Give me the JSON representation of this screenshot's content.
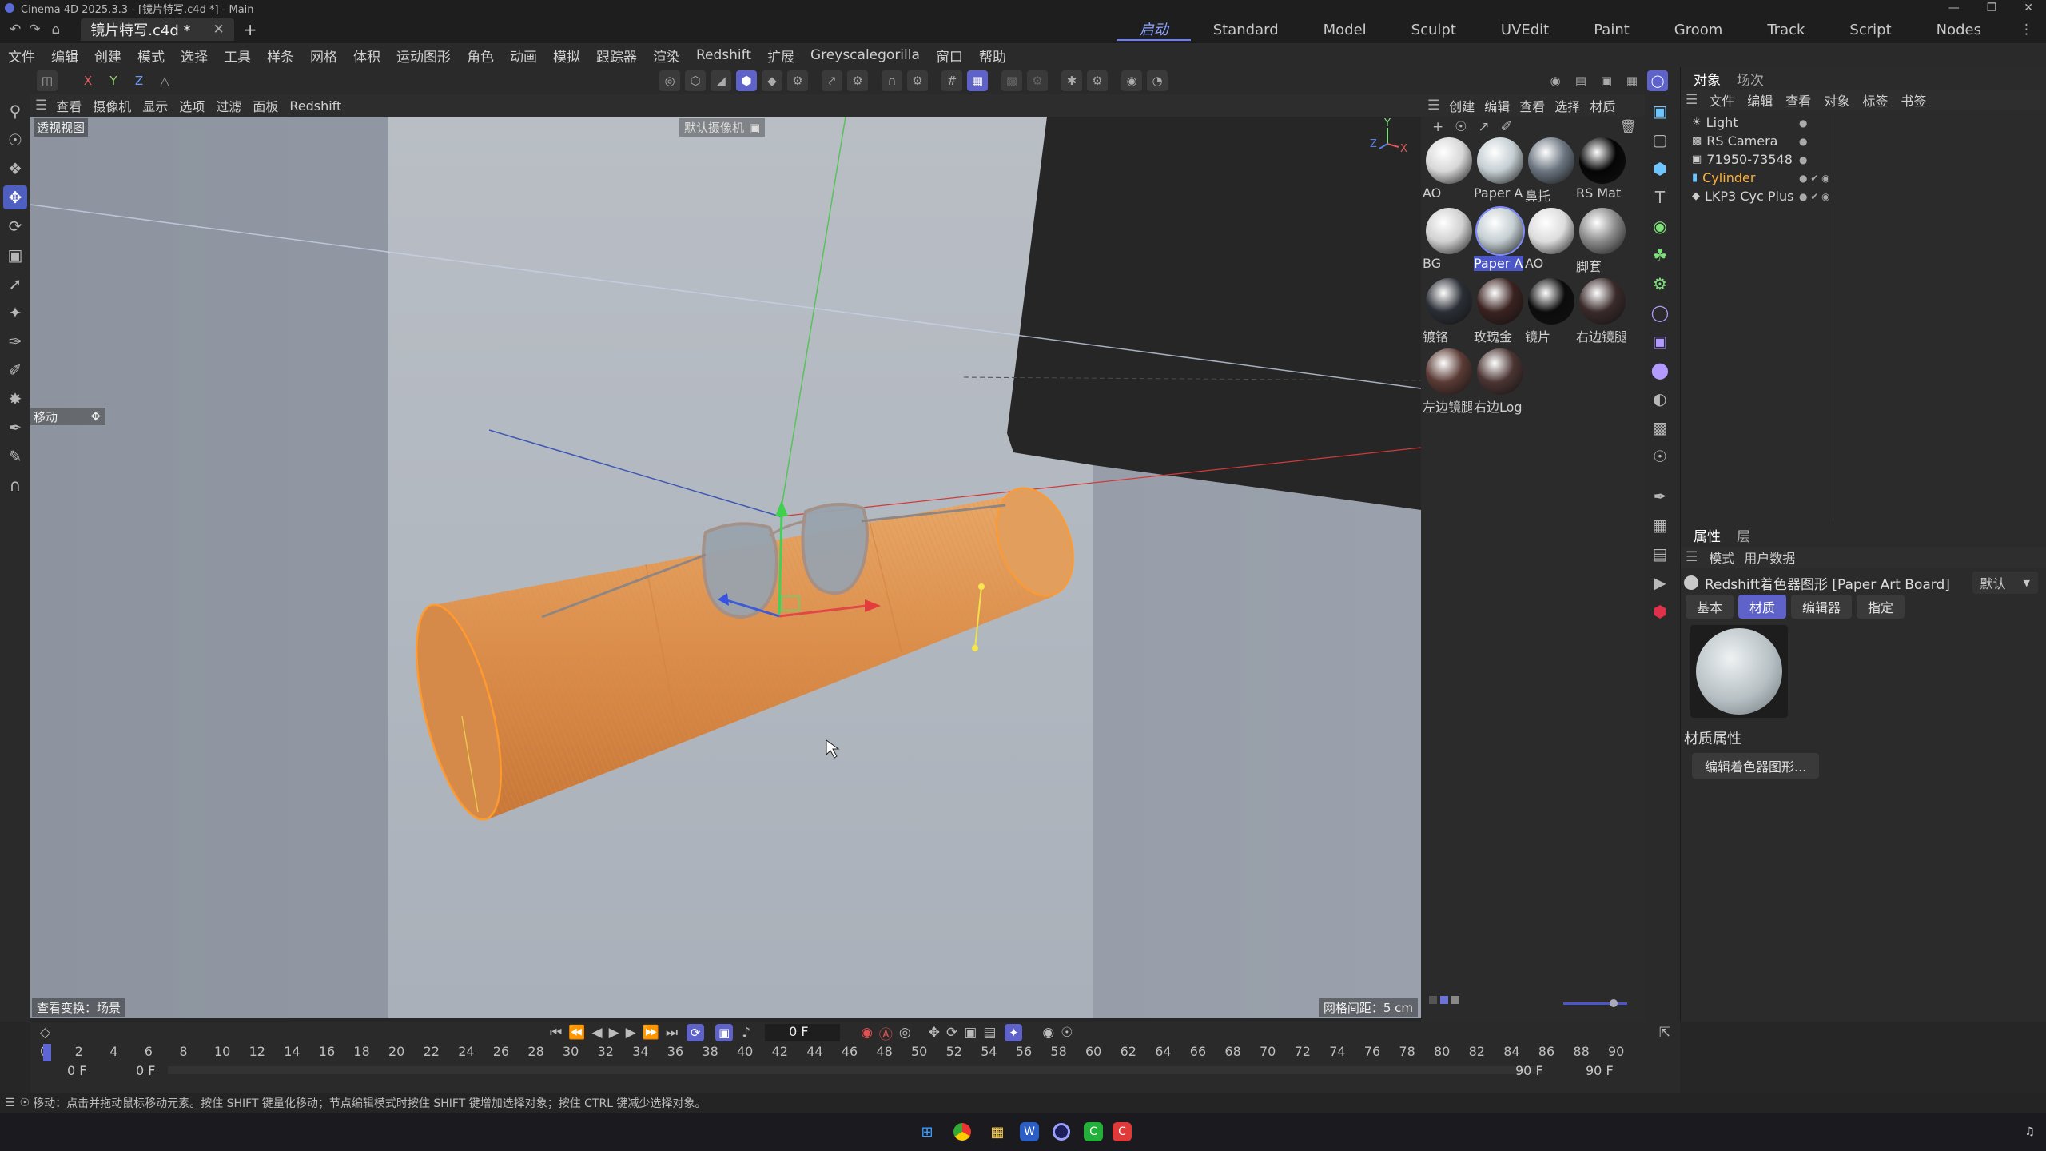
{
  "window": {
    "title": "Cinema 4D 2025.3.3 - [镜片特写.c4d *] - Main"
  },
  "document_tab": {
    "name": "镜片特写.c4d *"
  },
  "layouts": [
    {
      "label": "启动"
    },
    {
      "label": "Standard"
    },
    {
      "label": "Model"
    },
    {
      "label": "Sculpt"
    },
    {
      "label": "UVEdit"
    },
    {
      "label": "Paint"
    },
    {
      "label": "Groom"
    },
    {
      "label": "Track"
    },
    {
      "label": "Script"
    },
    {
      "label": "Nodes"
    }
  ],
  "menu": [
    "文件",
    "编辑",
    "创建",
    "模式",
    "选择",
    "工具",
    "样条",
    "网格",
    "体积",
    "运动图形",
    "角色",
    "动画",
    "模拟",
    "跟踪器",
    "渲染",
    "Redshift",
    "扩展",
    "Greyscalegorilla",
    "窗口",
    "帮助"
  ],
  "axis_buttons": [
    "X",
    "Y",
    "Z"
  ],
  "viewport_menu": [
    "查看",
    "摄像机",
    "显示",
    "选项",
    "过滤",
    "面板",
    "Redshift"
  ],
  "viewport": {
    "view_name": "透视视图",
    "camera_label": "默认摄像机",
    "move_label": "移动",
    "bottom_left": "查看变换：场景",
    "grid_spacing": "网格间距：5 cm"
  },
  "mat_menu": [
    "创建",
    "编辑",
    "查看",
    "选择",
    "材质"
  ],
  "materials": [
    {
      "name": "AO",
      "color": "#d7d7d7"
    },
    {
      "name": "Paper A",
      "color": "#c4ced2"
    },
    {
      "name": "鼻托",
      "color": "#6b7580"
    },
    {
      "name": "RS Mat",
      "color": "#050505"
    },
    {
      "name": "BG",
      "color": "#d0d0d0"
    },
    {
      "name": "Paper A",
      "color": "#c4ced2"
    },
    {
      "name": "AO",
      "color": "#dcdcdc"
    },
    {
      "name": "脚套",
      "color": "#8a8a8a"
    },
    {
      "name": "镀铬",
      "color": "#2a2e35"
    },
    {
      "name": "玫瑰金",
      "color": "#3a2220"
    },
    {
      "name": "镜片",
      "color": "#0c0c0c"
    },
    {
      "name": "右边镜腿",
      "color": "#3a2a2a"
    },
    {
      "name": "左边镜腿",
      "color": "#5a3a34"
    },
    {
      "name": "右边Logo",
      "color": "#4a3432"
    }
  ],
  "object_panel": {
    "tabs": [
      "对象",
      "场次"
    ],
    "menu": [
      "文件",
      "编辑",
      "查看",
      "对象",
      "标签",
      "书签"
    ],
    "objects": [
      {
        "name": "Light"
      },
      {
        "name": "RS Camera"
      },
      {
        "name": "71950-73548"
      },
      {
        "name": "Cylinder"
      },
      {
        "name": "LKP3 Cyc Plus"
      }
    ]
  },
  "attr_panel": {
    "tabs": [
      "属性",
      "层"
    ],
    "menu": [
      "模式",
      "用户数据"
    ],
    "title": "Redshift着色器图形 [Paper Art Board]",
    "preset": "默认",
    "buttons": [
      "基本",
      "材质",
      "编辑器",
      "指定"
    ],
    "section": "材质属性",
    "edit_button": "编辑着色器图形..."
  },
  "timeline": {
    "current_frame": "0 F",
    "ticks": [
      "0",
      "2",
      "4",
      "6",
      "8",
      "10",
      "12",
      "14",
      "16",
      "18",
      "20",
      "22",
      "24",
      "26",
      "28",
      "30",
      "32",
      "34",
      "36",
      "38",
      "40",
      "42",
      "44",
      "46",
      "48",
      "50",
      "52",
      "54",
      "56",
      "58",
      "60",
      "62",
      "64",
      "66",
      "68",
      "70",
      "72",
      "74",
      "76",
      "78",
      "80",
      "82",
      "84",
      "86",
      "88",
      "90"
    ],
    "start_a": "0 F",
    "start_b": "0 F",
    "end_a": "90 F",
    "end_b": "90 F"
  },
  "status": "移动：点击并拖动鼠标移动元素。按住 SHIFT 键量化移动；节点编辑模式时按住 SHIFT 键增加选择对象；按住 CTRL 键减少选择对象。",
  "taskbar_icons": [
    "windows-icon",
    "chrome-icon",
    "folder-icon",
    "word-icon",
    "cinema4d-icon",
    "app-green-icon",
    "app-red-icon"
  ]
}
